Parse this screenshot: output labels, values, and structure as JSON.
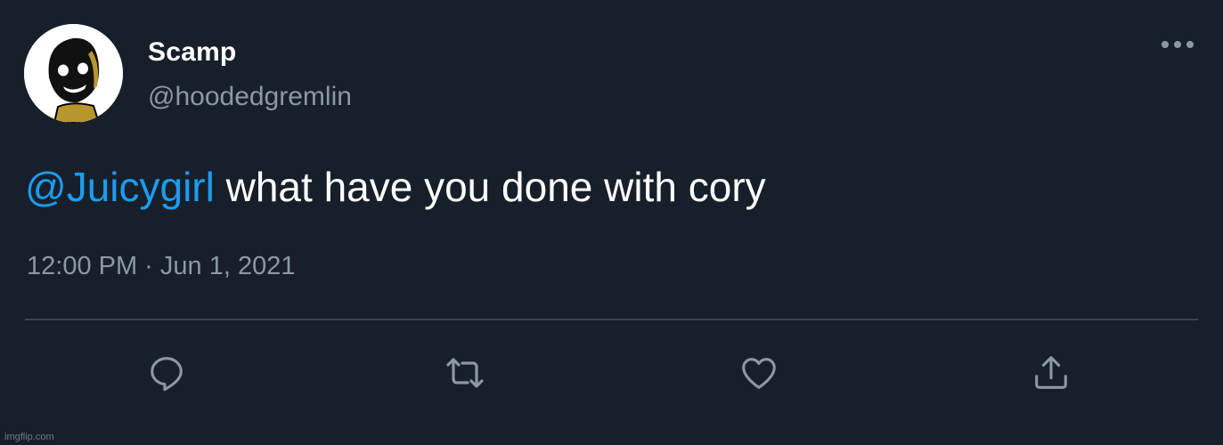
{
  "tweet": {
    "author": {
      "display_name": "Scamp",
      "handle": "@hoodedgremlin"
    },
    "text": {
      "mention": "@Juicygirl",
      "body": " what have you done with cory"
    },
    "timestamp": "12:00 PM · Jun 1, 2021"
  },
  "actions": {
    "reply_icon": "reply-icon",
    "retweet_icon": "retweet-icon",
    "like_icon": "heart-icon",
    "share_icon": "share-icon"
  },
  "watermark": "imgflip.com",
  "colors": {
    "background": "#17202a",
    "mention": "#1d9bf0",
    "secondary_text": "#8b98a5",
    "divider": "#38444d"
  }
}
